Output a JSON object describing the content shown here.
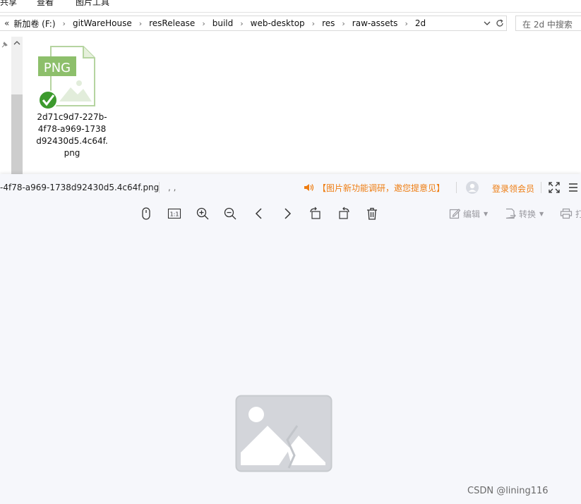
{
  "ribbon": {
    "tabs": [
      "共享",
      "查看",
      "图片工具"
    ]
  },
  "address_bar": {
    "overflow": "«",
    "breadcrumbs": [
      "新加卷 (F:)",
      "gitWareHouse",
      "resRelease",
      "build",
      "web-desktop",
      "res",
      "raw-assets",
      "2d"
    ],
    "search_placeholder": "在 2d 中搜索"
  },
  "file": {
    "badge": "PNG",
    "name": "2d71c9d7-227b-4f78-a969-1738d92430d5.4c64f.png"
  },
  "viewer": {
    "title": "-4f78-a969-1738d92430d5.4c64f.png",
    "dots": ", ,",
    "notice": "【图片新功能调研，邀您提意见】",
    "login": "登录领会员",
    "tools": {
      "edit": "编辑",
      "convert": "转换",
      "print": "打"
    }
  },
  "watermark": "CSDN @lining116",
  "colors": {
    "accent": "#ee7d12",
    "viewer_bg": "#f6f7fb",
    "png_green": "#8dbf6b"
  }
}
